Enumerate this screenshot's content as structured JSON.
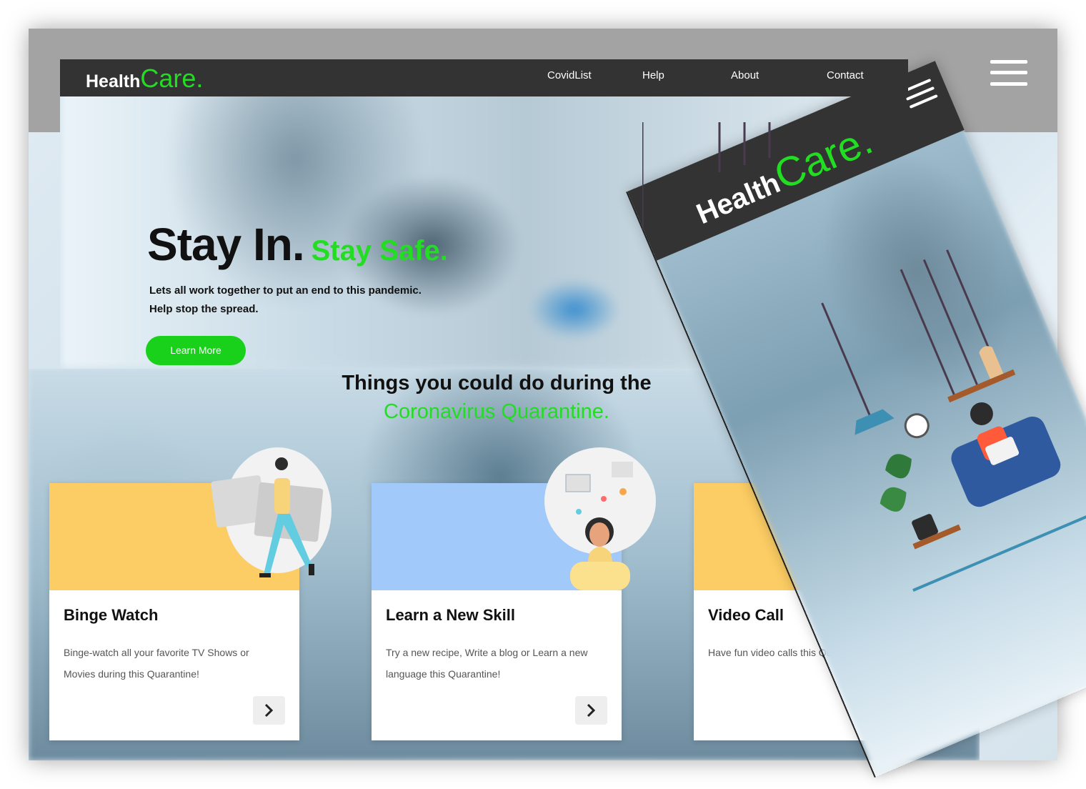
{
  "brand": {
    "word1": "Health",
    "word2": "Care.",
    "accent_color": "#22dd22",
    "nav_bg": "#333333"
  },
  "nav": {
    "items": [
      "CovidList",
      "Help",
      "About",
      "Contact"
    ]
  },
  "hero": {
    "title_dark": "Stay In.",
    "title_accent": "Stay Safe.",
    "subtitle_line1": "Lets all work together to put an end to this pandemic.",
    "subtitle_line2": "Help stop the spread.",
    "button_label": "Learn More"
  },
  "section": {
    "title_line1": "Things you could do during the",
    "title_line2": "Coronavirus Quarantine."
  },
  "cards": [
    {
      "title": "Binge Watch",
      "text": "Binge-watch all your favorite TV Shows or Movies during this Quarantine!",
      "color": "#fccd64",
      "icon": "chevron-right-icon"
    },
    {
      "title": "Learn a New Skill",
      "text": "Try a new recipe, Write a blog or Learn a new language this Quarantine!",
      "color": "#a1c9fa",
      "icon": "chevron-right-icon"
    },
    {
      "title": "Video Call",
      "text": "Have fun video calls this Quarantine!",
      "color": "#fccd64",
      "icon": "chevron-right-icon"
    }
  ],
  "icons": {
    "menu": "hamburger-icon",
    "arrow": "chevron-right-icon"
  }
}
